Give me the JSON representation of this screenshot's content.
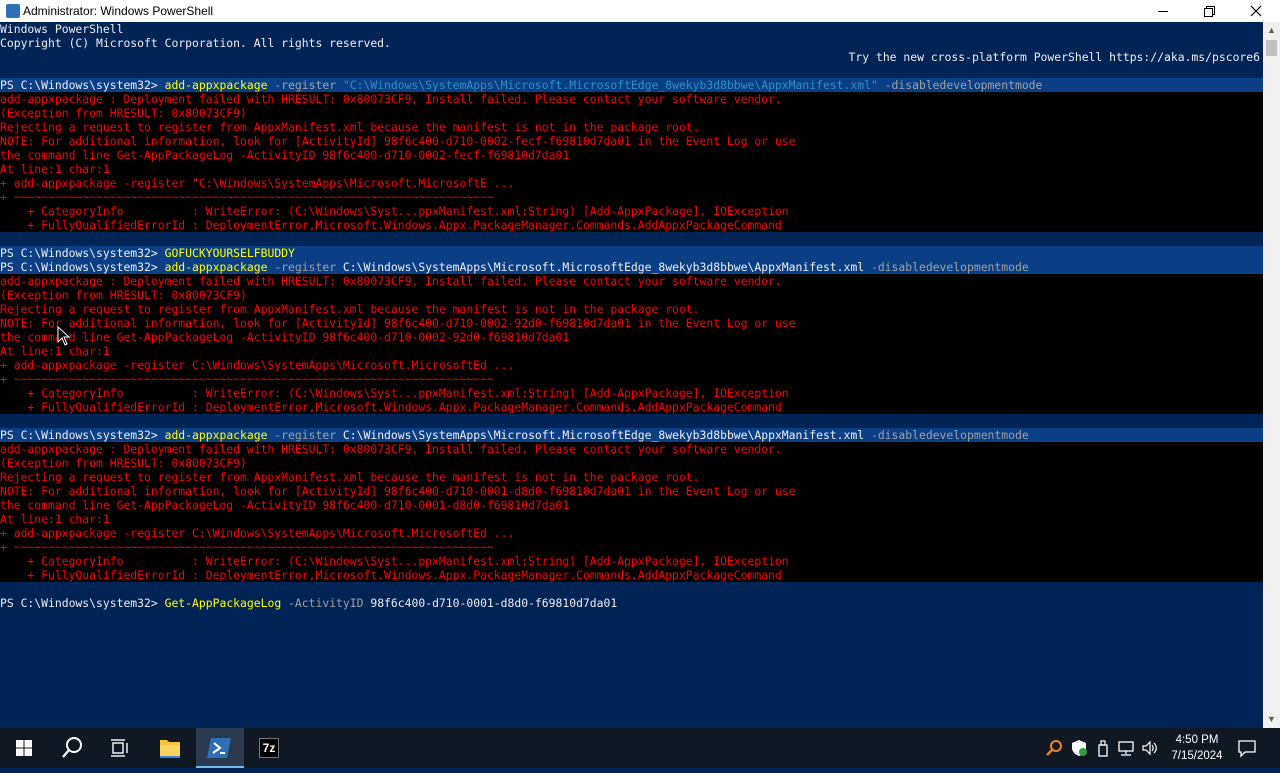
{
  "window": {
    "title": "Administrator: Windows PowerShell"
  },
  "console": {
    "header": [
      "Windows PowerShell",
      "Copyright (C) Microsoft Corporation. All rights reserved."
    ],
    "header_right": "Try the new cross-platform PowerShell https://aka.ms/pscore6",
    "prompt": "PS C:\\Windows\\system32> ",
    "commands": [
      {
        "cmd": "add-appxpackage",
        "param": " -register ",
        "arg": "\"C:\\Windows\\SystemApps\\Microsoft.MicrosoftEdge_8wekyb3d8bbwe\\AppxManifest.xml\"",
        "flag": " -disabledevelopmentmode",
        "errors": [
          "add-appxpackage : Deployment failed with HRESULT: 0x80073CF9, Install failed. Please contact your software vendor.",
          "(Exception from HRESULT: 0x80073CF9)",
          "Rejecting a request to register from AppxManifest.xml because the manifest is not in the package root.",
          "NOTE: For additional information, look for [ActivityId] 98f6c400-d710-0002-fecf-f69810d7da01 in the Event Log or use",
          "the command line Get-AppPackageLog -ActivityID 98f6c400-d710-0002-fecf-f69810d7da01",
          "At line:1 char:1",
          "+ add-appxpackage -register \"C:\\Windows\\SystemApps\\Microsoft.MicrosoftE ...",
          "+ ~~~~~~~~~~~~~~~~~~~~~~~~~~~~~~~~~~~~~~~~~~~~~~~~~~~~~~~~~~~~~~~~~~~~~~",
          "    + CategoryInfo          : WriteError: (C:\\Windows\\Syst...ppxManifest.xml:String) [Add-AppxPackage], IOException",
          "    + FullyQualifiedErrorId : DeploymentError,Microsoft.Windows.Appx.PackageManager.Commands.AddAppxPackageCommand"
        ]
      },
      {
        "cmd": "GOFUCKYOURSELFBUDDY",
        "param": "",
        "arg": "",
        "flag": "",
        "errors": []
      },
      {
        "cmd": "add-appxpackage",
        "param": " -register ",
        "arg": "C:\\Windows\\SystemApps\\Microsoft.MicrosoftEdge_8wekyb3d8bbwe\\AppxManifest.xml",
        "flag": " -disabledevelopmentmode",
        "errors": [
          "add-appxpackage : Deployment failed with HRESULT: 0x80073CF9, Install failed. Please contact your software vendor.",
          "(Exception from HRESULT: 0x80073CF9)",
          "Rejecting a request to register from AppxManifest.xml because the manifest is not in the package root.",
          "NOTE: For additional information, look for [ActivityId] 98f6c400-d710-0002-92d0-f69810d7da01 in the Event Log or use",
          "the command line Get-AppPackageLog -ActivityID 98f6c400-d710-0002-92d0-f69810d7da01",
          "At line:1 char:1",
          "+ add-appxpackage -register C:\\Windows\\SystemApps\\Microsoft.MicrosoftEd ...",
          "+ ~~~~~~~~~~~~~~~~~~~~~~~~~~~~~~~~~~~~~~~~~~~~~~~~~~~~~~~~~~~~~~~~~~~~~~",
          "    + CategoryInfo          : WriteError: (C:\\Windows\\Syst...ppxManifest.xml:String) [Add-AppxPackage], IOException",
          "    + FullyQualifiedErrorId : DeploymentError,Microsoft.Windows.Appx.PackageManager.Commands.AddAppxPackageCommand"
        ]
      },
      {
        "cmd": "add-appxpackage",
        "param": " -register ",
        "arg": "C:\\Windows\\SystemApps\\Microsoft.MicrosoftEdge_8wekyb3d8bbwe\\AppxManifest.xml",
        "flag": " -disabledevelopmentmode",
        "errors": [
          "add-appxpackage : Deployment failed with HRESULT: 0x80073CF9, Install failed. Please contact your software vendor.",
          "(Exception from HRESULT: 0x80073CF9)",
          "Rejecting a request to register from AppxManifest.xml because the manifest is not in the package root.",
          "NOTE: For additional information, look for [ActivityId] 98f6c400-d710-0001-d8d0-f69810d7da01 in the Event Log or use",
          "the command line Get-AppPackageLog -ActivityID 98f6c400-d710-0001-d8d0-f69810d7da01",
          "At line:1 char:1",
          "+ add-appxpackage -register C:\\Windows\\SystemApps\\Microsoft.MicrosoftEd ...",
          "+ ~~~~~~~~~~~~~~~~~~~~~~~~~~~~~~~~~~~~~~~~~~~~~~~~~~~~~~~~~~~~~~~~~~~~~~",
          "    + CategoryInfo          : WriteError: (C:\\Windows\\Syst...ppxManifest.xml:String) [Add-AppxPackage], IOException",
          "    + FullyQualifiedErrorId : DeploymentError,Microsoft.Windows.Appx.PackageManager.Commands.AddAppxPackageCommand"
        ]
      },
      {
        "cmd": "Get-AppPackageLog",
        "param": " -ActivityID ",
        "arg": "98f6c400-d710-0001-d8d0-f69810d7da01",
        "flag": "",
        "errors": []
      }
    ]
  },
  "taskbar": {
    "items": [
      "windows-start",
      "search",
      "task-view",
      "file-explorer",
      "powershell",
      "7-zip"
    ],
    "sevenzip_label": "7z",
    "time": "4:50 PM",
    "date": "7/15/2024"
  },
  "colors": {
    "console_bg": "#012456",
    "error_red": "#ff0000",
    "command_yellow": "#ffff00",
    "taskbar_bg": "#101823"
  }
}
